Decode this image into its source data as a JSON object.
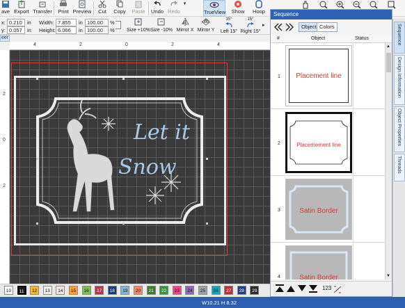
{
  "toolbar": {
    "buttons": [
      {
        "label": "ave"
      },
      {
        "label": "Export"
      },
      {
        "label": "Transfer"
      },
      {
        "label": "Print"
      },
      {
        "label": "Preview"
      },
      {
        "label": "Cut"
      },
      {
        "label": "Copy"
      },
      {
        "label": "Paste"
      },
      {
        "label": "Undo"
      },
      {
        "label": "Redo"
      },
      {
        "label": "TrueView"
      },
      {
        "label": "Show"
      },
      {
        "label": "Hoop"
      }
    ]
  },
  "propbar": {
    "x_label": "x:",
    "x_value": "0.210",
    "x_unit": "in",
    "y_label": "y:",
    "y_value": "0.057",
    "y_unit": "in",
    "width_label": "Width:",
    "width_value": "7.855",
    "width_unit": "in",
    "height_label": "Height:",
    "height_value": "6.066",
    "height_unit": "in",
    "scale_w": "100.00",
    "scale_h": "100.00",
    "pct": "%",
    "buttons": [
      {
        "label": "Size +10%"
      },
      {
        "label": "Size -10%"
      },
      {
        "label": "Mirror X"
      },
      {
        "label": "Mirror Y"
      },
      {
        "label": "Left 15°",
        "badge": "15°"
      },
      {
        "label": "Right 15°",
        "badge": "15°"
      }
    ]
  },
  "doc_tab": "eer",
  "ruler": {
    "h": [
      "4",
      "2",
      "0",
      "2",
      "4"
    ],
    "v": [
      "2",
      "0",
      "2"
    ]
  },
  "design": {
    "text_line1": "Let it",
    "text_line2": "Snow"
  },
  "colors": [
    {
      "num": "10",
      "hex": "#ffffff"
    },
    {
      "num": "11",
      "hex": "#1a1a1a"
    },
    {
      "num": "12",
      "hex": "#f2b632"
    },
    {
      "num": "13",
      "hex": "#f3f1e6"
    },
    {
      "num": "14",
      "hex": "#f5e7de"
    },
    {
      "num": "15",
      "hex": "#f6a23b"
    },
    {
      "num": "16",
      "hex": "#7dc04a"
    },
    {
      "num": "17",
      "hex": "#b33a4d"
    },
    {
      "num": "18",
      "hex": "#1a3c7a"
    },
    {
      "num": "19",
      "hex": "#7fb6d9"
    },
    {
      "num": "20",
      "hex": "#f08a6e"
    },
    {
      "num": "21",
      "hex": "#3f7a32"
    },
    {
      "num": "22",
      "hex": "#3c8f3c"
    },
    {
      "num": "23",
      "hex": "#e84a86"
    },
    {
      "num": "24",
      "hex": "#8d6ab0"
    },
    {
      "num": "25",
      "hex": "#9ba1a6"
    },
    {
      "num": "26",
      "hex": "#17a4c0"
    },
    {
      "num": "27",
      "hex": "#b8343a"
    },
    {
      "num": "28",
      "hex": "#1f3e8a"
    },
    {
      "num": "29",
      "hex": "#2c2c2c"
    }
  ],
  "status": {
    "size": "W10.21 H 8.32"
  },
  "sequence": {
    "title": "Sequence",
    "tabs": [
      "Objects",
      "Colors"
    ],
    "columns": {
      "num": "#",
      "object": "Object",
      "status": "Status"
    },
    "rows": [
      {
        "num": "1",
        "label": "Placement line"
      },
      {
        "num": "2",
        "label": "Placemement line"
      },
      {
        "num": "3",
        "label": "Satin Border"
      },
      {
        "num": "4",
        "label": "Satin Border"
      }
    ],
    "bottom_label": "123"
  },
  "side_tabs": [
    "Sequence",
    "Design Information",
    "Object Properties",
    "Threads"
  ]
}
